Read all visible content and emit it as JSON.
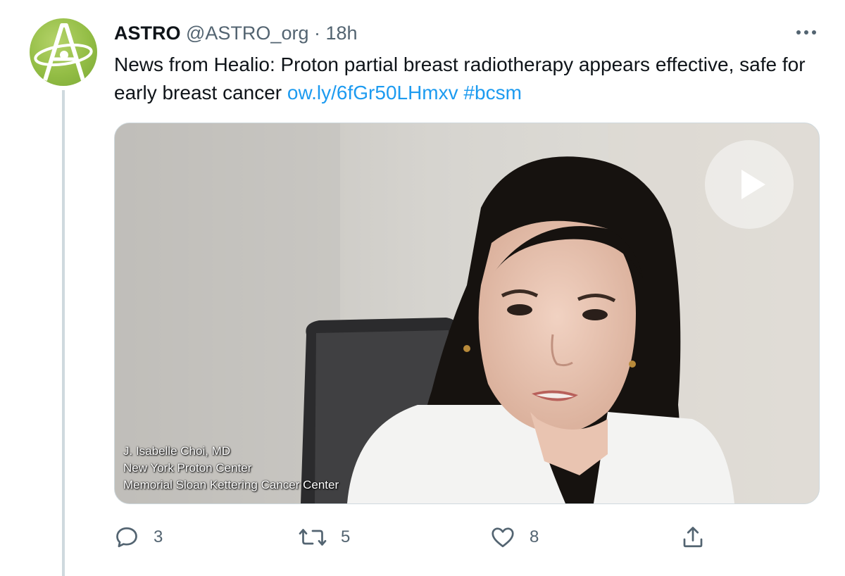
{
  "tweet": {
    "author_name": "ASTRO",
    "handle": "@ASTRO_org",
    "separator": "·",
    "time": "18h",
    "text_prefix": "News from Healio: Proton partial breast radiotherapy appears effective, safe for early breast cancer",
    "link": "ow.ly/6fGr50LHmxv",
    "hashtag": "#bcsm"
  },
  "avatar": {
    "icon": "astro-logo-icon",
    "bg": "#93bd45"
  },
  "media": {
    "type": "video",
    "caption": [
      "J. Isabelle Choi, MD",
      "New York Proton Center",
      "Memorial Sloan Kettering Cancer Center"
    ]
  },
  "actions": {
    "reply_count": "3",
    "retweet_count": "5",
    "like_count": "8"
  },
  "colors": {
    "link": "#1d9bf0",
    "secondary_text": "#536471",
    "thread_line": "#cfd9de"
  }
}
